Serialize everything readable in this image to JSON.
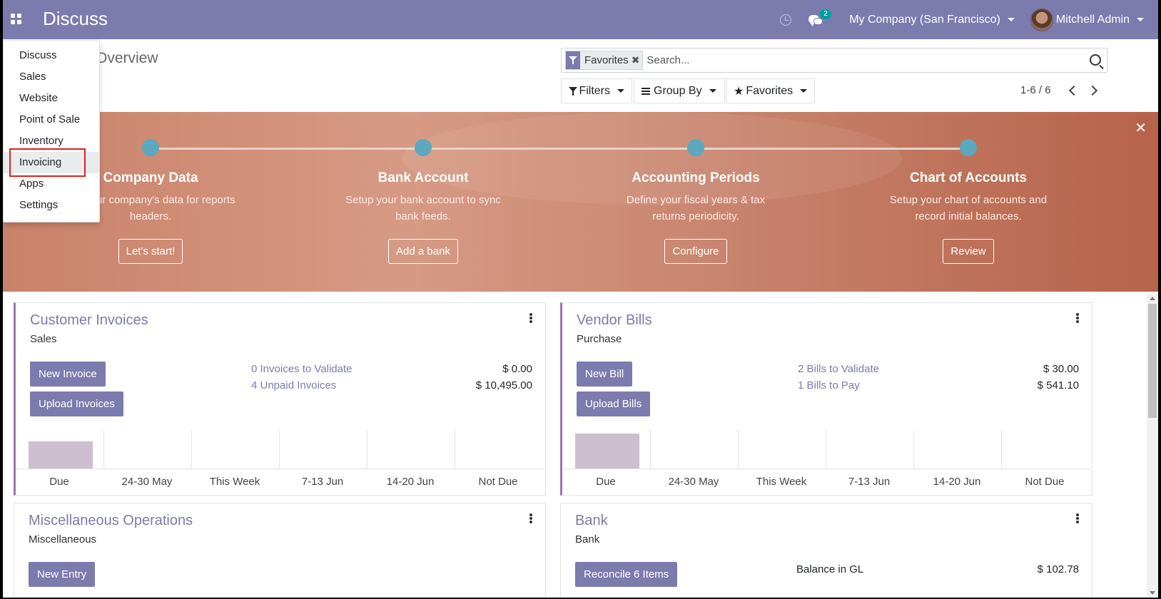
{
  "navbar": {
    "app_title": "Discuss",
    "chat_count": "2",
    "company": "My Company (San Francisco)",
    "user": "Mitchell Admin",
    "brand_color": "#7c7bad"
  },
  "app_menu": {
    "items": [
      "Discuss",
      "Sales",
      "Website",
      "Point of Sale",
      "Inventory",
      "Invoicing",
      "Apps",
      "Settings"
    ],
    "highlighted": "Invoicing"
  },
  "control_panel": {
    "breadcrumb": "Overview",
    "facet_label": "Favorites",
    "search_placeholder": "Search...",
    "filters_label": "Filters",
    "groupby_label": "Group By",
    "favorites_label": "Favorites",
    "pager": "1-6 / 6"
  },
  "onboarding": {
    "steps": [
      {
        "title": "Company Data",
        "desc": "Set your company's data for reports headers.",
        "button": "Let's start!"
      },
      {
        "title": "Bank Account",
        "desc": "Setup your bank account to sync bank feeds.",
        "button": "Add a bank"
      },
      {
        "title": "Accounting Periods",
        "desc": "Define your fiscal years & tax returns periodicity.",
        "button": "Configure"
      },
      {
        "title": "Chart of Accounts",
        "desc": "Setup your chart of accounts and record initial balances.",
        "button": "Review"
      }
    ]
  },
  "cards": {
    "customer": {
      "title": "Customer Invoices",
      "subtitle": "Sales",
      "btn1": "New Invoice",
      "btn2": "Upload Invoices",
      "stats": [
        {
          "label": "0 Invoices to Validate",
          "value": "$ 0.00"
        },
        {
          "label": "4 Unpaid Invoices",
          "value": "$ 10,495.00"
        }
      ],
      "graph_labels": [
        "Due",
        "24-30 May",
        "This Week",
        "7-13 Jun",
        "14-20 Jun",
        "Not Due"
      ],
      "graph_values": [
        0.7,
        0,
        0,
        0,
        0,
        0
      ]
    },
    "vendor": {
      "title": "Vendor Bills",
      "subtitle": "Purchase",
      "btn1": "New Bill",
      "btn2": "Upload Bills",
      "stats": [
        {
          "label": "2 Bills to Validate",
          "value": "$ 30.00"
        },
        {
          "label": "1 Bills to Pay",
          "value": "$ 541.10"
        }
      ],
      "graph_labels": [
        "Due",
        "24-30 May",
        "This Week",
        "7-13 Jun",
        "14-20 Jun",
        "Not Due"
      ],
      "graph_values": [
        0.9,
        0,
        0,
        0,
        0,
        0
      ]
    },
    "misc": {
      "title": "Miscellaneous Operations",
      "subtitle": "Miscellaneous",
      "btn1": "New Entry"
    },
    "bank": {
      "title": "Bank",
      "subtitle": "Bank",
      "btn1": "Reconcile 6 Items",
      "stat_label": "Balance in GL",
      "stat_value": "$ 102.78"
    }
  }
}
